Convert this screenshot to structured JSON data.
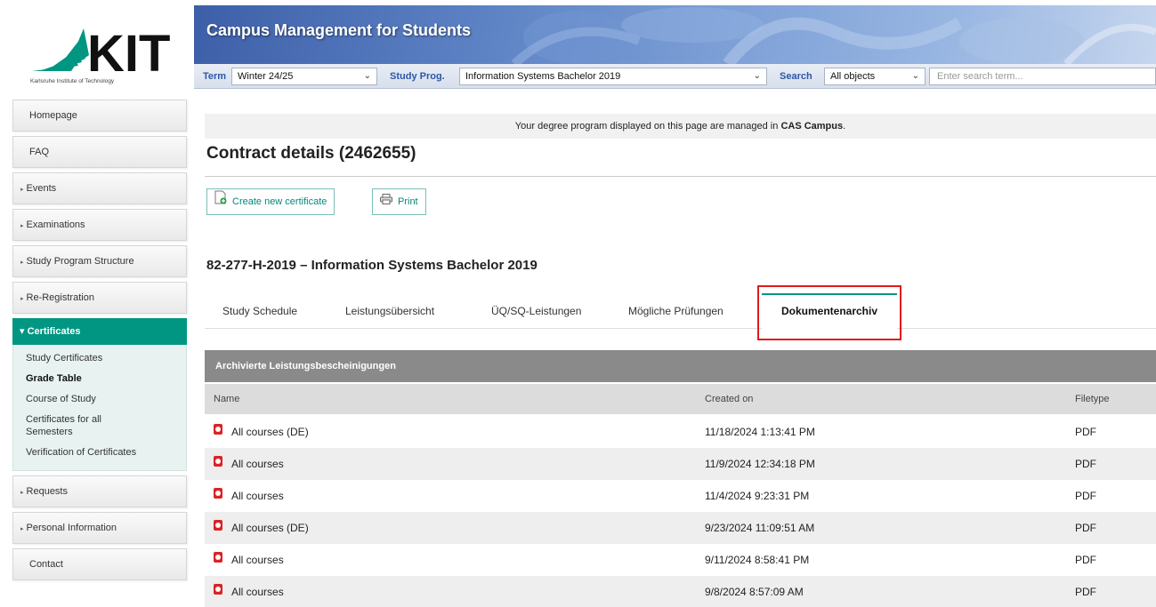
{
  "logo": {
    "wordmark": "KIT",
    "subtitle": "Karlsruhe Institute of Technology"
  },
  "banner": {
    "title": "Campus Management for Students"
  },
  "filters": {
    "term_label": "Term",
    "term_value": "Winter 24/25",
    "study_label": "Study Prog.",
    "study_value": "Information Systems Bachelor 2019",
    "search_label": "Search",
    "search_scope": "All objects",
    "search_placeholder": "Enter search term..."
  },
  "sidebar": {
    "items": [
      {
        "label": "Homepage"
      },
      {
        "label": "FAQ"
      },
      {
        "label": "Events"
      },
      {
        "label": "Examinations"
      },
      {
        "label": "Study Program Structure"
      },
      {
        "label": "Re-Registration"
      }
    ],
    "active": "Certificates",
    "sub_items": [
      {
        "label": "Study Certificates"
      },
      {
        "label": "Grade Table"
      },
      {
        "label": "Course of Study"
      },
      {
        "label": "Certificates for all Semesters"
      },
      {
        "label": "Verification of Certificates"
      }
    ],
    "items_after": [
      {
        "label": "Requests"
      },
      {
        "label": "Personal Information"
      },
      {
        "label": "Contact"
      }
    ]
  },
  "notice": {
    "text_before": "Your degree program displayed on this page are managed in ",
    "bold": "CAS Campus",
    "text_after": "."
  },
  "page": {
    "title": "Contract details (2462655)",
    "create_button": "Create new certificate",
    "print_button": "Print",
    "subtitle": "82-277-H-2019 – Information Systems Bachelor 2019"
  },
  "tabs": [
    {
      "label": "Study Schedule"
    },
    {
      "label": "Leistungsübersicht"
    },
    {
      "label": "ÜQ/SQ-Leistungen"
    },
    {
      "label": "Mögliche Prüfungen"
    },
    {
      "label": "Dokumentenarchiv"
    }
  ],
  "table": {
    "title": "Archivierte Leistungsbescheinigungen",
    "columns": [
      "Name",
      "Created on",
      "Filetype"
    ],
    "rows": [
      [
        "All courses (DE)",
        "11/18/2024 1:13:41 PM",
        "PDF"
      ],
      [
        "All courses",
        "11/9/2024 12:34:18 PM",
        "PDF"
      ],
      [
        "All courses",
        "11/4/2024 9:23:31 PM",
        "PDF"
      ],
      [
        "All courses (DE)",
        "9/23/2024 11:09:51 AM",
        "PDF"
      ],
      [
        "All courses",
        "9/11/2024 8:58:41 PM",
        "PDF"
      ],
      [
        "All courses",
        "9/8/2024 8:57:09 AM",
        "PDF"
      ]
    ]
  },
  "colors": {
    "accent": "#009682",
    "banner": "#3d5fa8",
    "highlight_box": "#e01b1b"
  }
}
